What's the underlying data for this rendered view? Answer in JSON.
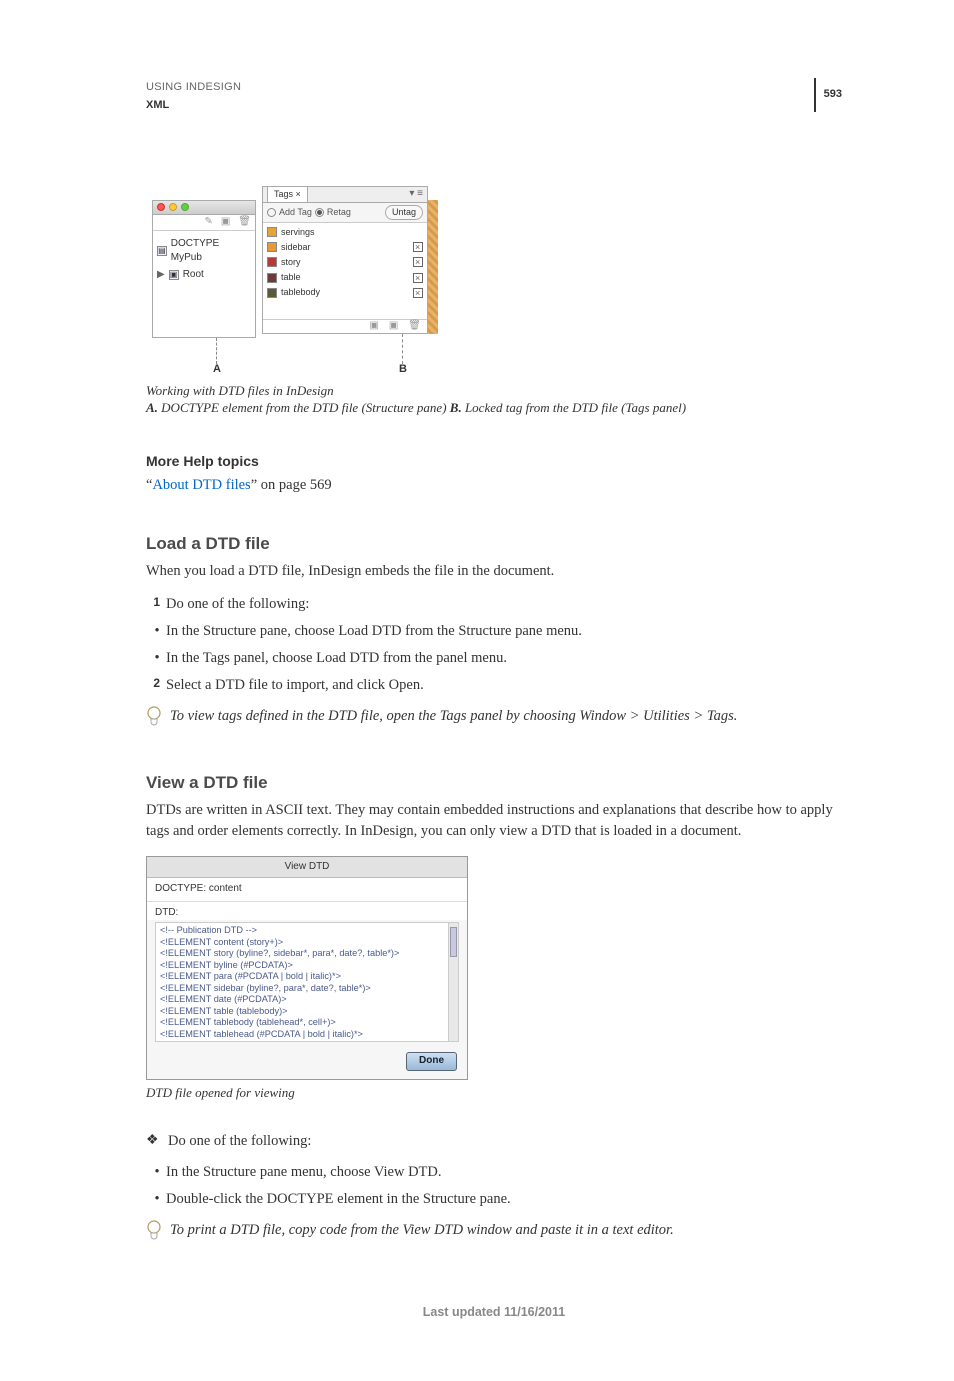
{
  "header": {
    "line1": "USING INDESIGN",
    "line2": "XML",
    "page_number": "593"
  },
  "figure1": {
    "structure_pane": {
      "doctype_text": "DOCTYPE MyPub",
      "root_text": "Root"
    },
    "tags_panel": {
      "tab": "Tags",
      "add_tag": "Add Tag",
      "retag": "Retag",
      "untag": "Untag",
      "tags": [
        {
          "name": "servings",
          "color": "#e8a23a"
        },
        {
          "name": "sidebar",
          "color": "#e8973a"
        },
        {
          "name": "story",
          "color": "#b53a3a"
        },
        {
          "name": "table",
          "color": "#6b3a3a"
        },
        {
          "name": "tablebody",
          "color": "#5a5a38"
        }
      ]
    },
    "caption_title": "Working with DTD files in InDesign",
    "caption_a_label": "A.",
    "caption_a_text": " DOCTYPE element from the DTD file (Structure pane)  ",
    "caption_b_label": "B.",
    "caption_b_text": " Locked tag from the DTD file (Tags panel)",
    "callout_a": "A",
    "callout_b": "B"
  },
  "more_help": {
    "heading": "More Help topics",
    "link_text": "About DTD files",
    "link_suffix": "” on page 569",
    "link_prefix": "“"
  },
  "load_dtd": {
    "heading": "Load a DTD file",
    "intro": "When you load a DTD file, InDesign embeds the file in the document.",
    "step1_intro": "Do one of the following:",
    "bullet1": "In the Structure pane, choose Load DTD from the Structure pane menu.",
    "bullet2": "In the Tags panel, choose Load DTD from the panel menu.",
    "step2": "Select a DTD file to import, and click Open.",
    "tip": "To view tags defined in the DTD file, open the Tags panel by choosing Window > Utilities > Tags."
  },
  "view_dtd": {
    "heading": "View a DTD file",
    "intro": "DTDs are written in ASCII text. They may contain embedded instructions and explanations that describe how to apply tags and order elements correctly. In InDesign, you can only view a DTD that is loaded in a document.",
    "dialog": {
      "title": "View DTD",
      "doctype_line": "DOCTYPE: content",
      "dtd_label": "DTD:",
      "code": "<!-- Publication DTD -->\n<!ELEMENT content (story+)>\n<!ELEMENT story (byline?, sidebar*, para*, date?, table*)>\n<!ELEMENT byline (#PCDATA)>\n<!ELEMENT para (#PCDATA | bold | italic)*>\n<!ELEMENT sidebar (byline?, para*, date?, table*)>\n<!ELEMENT date (#PCDATA)>\n<!ELEMENT table (tablebody)>\n<!ELEMENT tablebody (tablehead*, cell+)>\n<!ELEMENT tablehead (#PCDATA | bold | italic)*>\n<!ELEMENT cell (#PCDATA | bold | italic)*>\n<!ELEMENT bold (#PCDATA)>",
      "done": "Done"
    },
    "caption": "DTD file opened for viewing",
    "diamond_intro": "Do one of the following:",
    "bullet1": "In the Structure pane menu, choose View DTD.",
    "bullet2": "Double-click the DOCTYPE element in the Structure pane.",
    "tip": "To print a DTD file, copy code from the View DTD window and paste it in a text editor."
  },
  "footer": {
    "updated": "Last updated 11/16/2011"
  }
}
